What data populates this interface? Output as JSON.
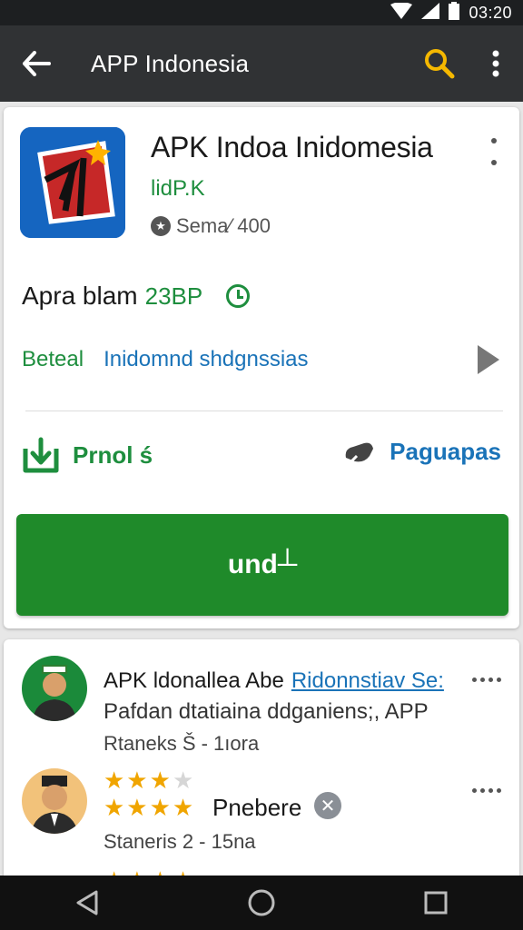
{
  "status_bar": {
    "time": "03:20"
  },
  "app_bar": {
    "title": "APP Indonesia"
  },
  "app": {
    "name": "APK Indoa Inidomesia",
    "developer": "lidP.K",
    "rating_text": "Sema⁄ 400"
  },
  "info": {
    "label": "Apra blam",
    "price": "23BP"
  },
  "links": {
    "detail": "Beteal",
    "description": "Inidomnd shdgnssias"
  },
  "actions": {
    "left_label": "Prnol ś",
    "right_label": "Paguapas"
  },
  "install_button": {
    "label": "und┴"
  },
  "reviews": [
    {
      "title": "APK ldonallea Abe",
      "link": "Ridonnstiav Se:",
      "text": "Pafdan dtatiaina ddganiens;, APP",
      "meta": "Rtaneks Š - 1ıora"
    },
    {
      "name": "Pnebere",
      "meta": "Staneris 2 - 15na",
      "stars_row1": 3,
      "stars_row2": 4
    }
  ],
  "colors": {
    "accent_green": "#1e8e3e",
    "link_blue": "#1a73b8",
    "app_bar": "#303234",
    "search_yellow": "#f5b800"
  }
}
